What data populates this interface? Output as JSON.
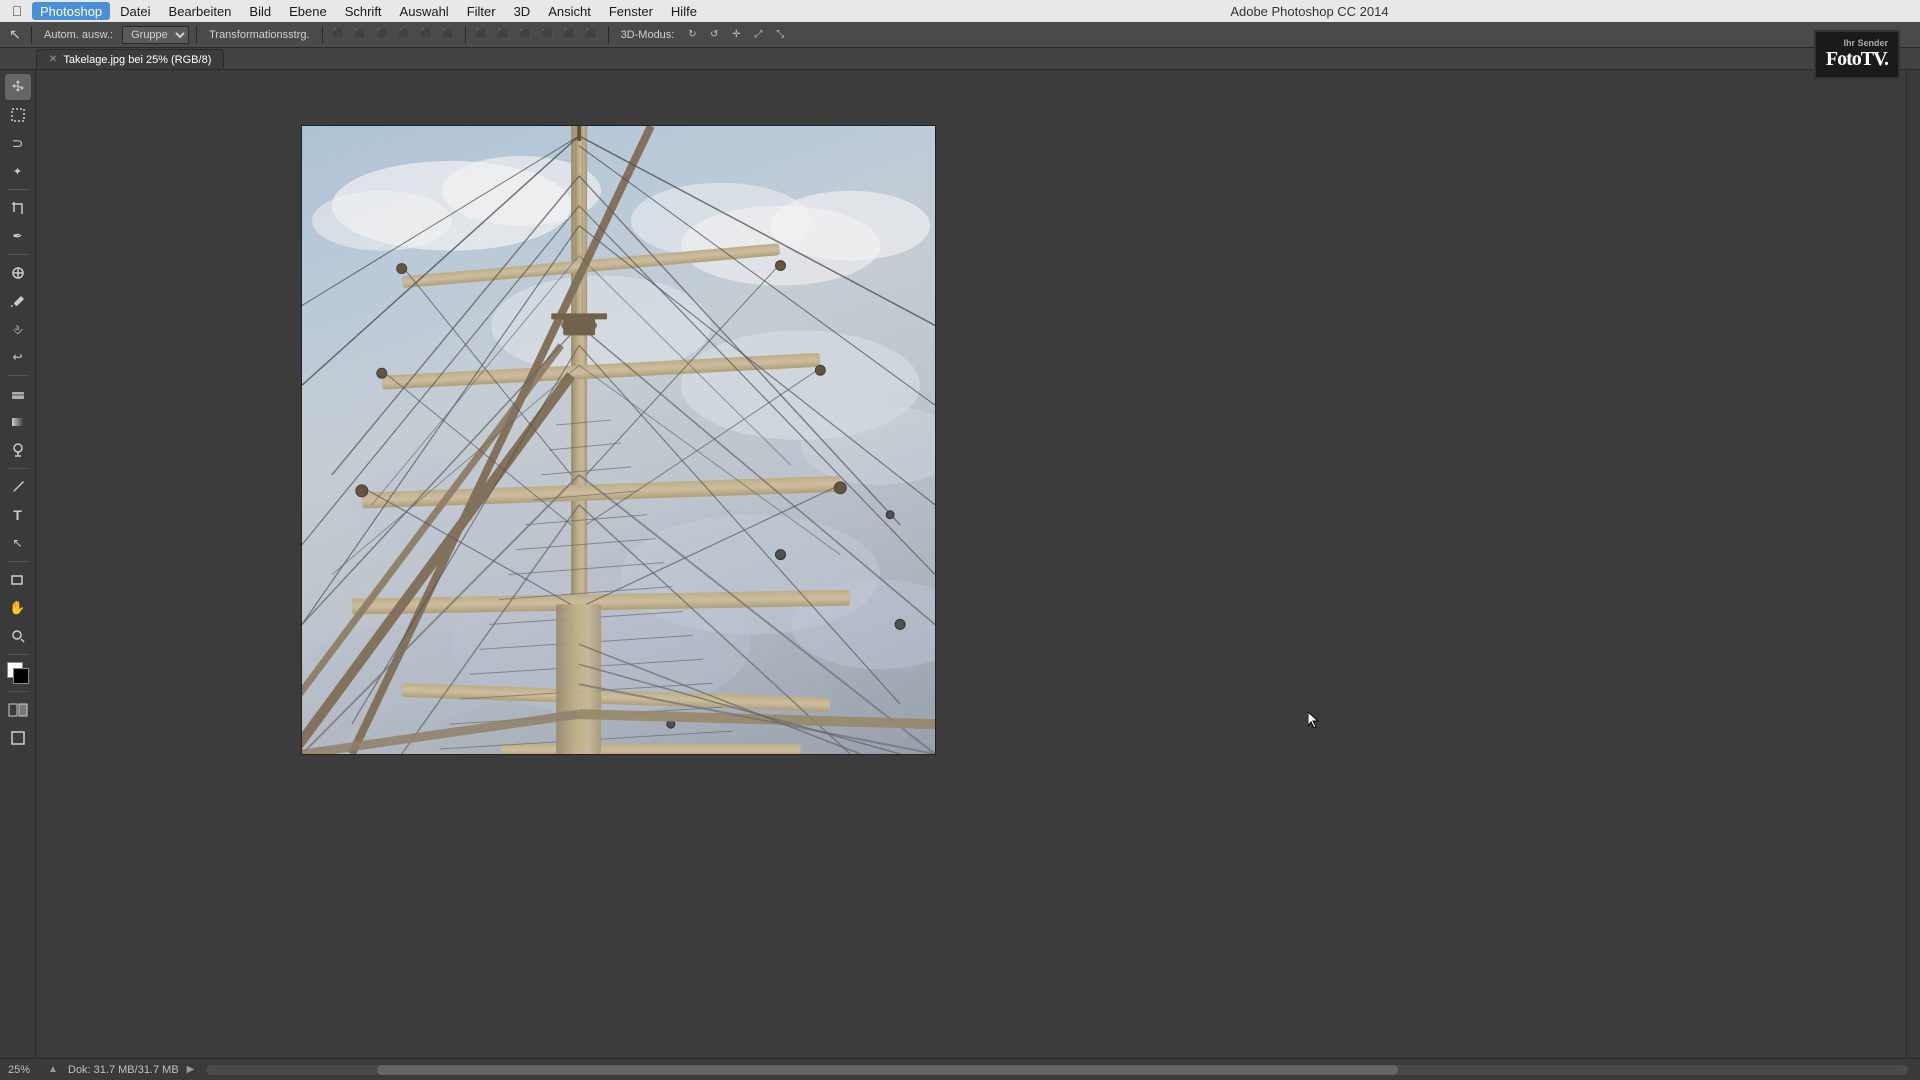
{
  "app": {
    "title": "Adobe Photoshop CC 2014",
    "name": "Photoshop"
  },
  "menubar": {
    "apple": "⌘",
    "items": [
      {
        "label": "Photoshop",
        "active": true
      },
      {
        "label": "Datei"
      },
      {
        "label": "Bearbeiten"
      },
      {
        "label": "Bild"
      },
      {
        "label": "Ebene"
      },
      {
        "label": "Schrift"
      },
      {
        "label": "Auswahl"
      },
      {
        "label": "Filter"
      },
      {
        "label": "3D"
      },
      {
        "label": "Ansicht"
      },
      {
        "label": "Fenster"
      },
      {
        "label": "Hilfe"
      }
    ]
  },
  "toolbar": {
    "autom_label": "Autom. ausw.:",
    "gruppe_label": "Gruppe",
    "transformation_label": "Transformationsstrg.",
    "modus_label": "3D-Modus:"
  },
  "tab": {
    "filename": "Takelage.jpg bei 25% (RGB/8)"
  },
  "statusbar": {
    "zoom": "25%",
    "doc_info": "Dok: 31.7 MB/31.7 MB"
  },
  "fototv": {
    "text": "FotoTV.",
    "subtitle": "Ihr Sender"
  },
  "tools": [
    {
      "name": "move-tool",
      "icon": "↖",
      "label": "Verschieben"
    },
    {
      "name": "marquee-tool",
      "icon": "⬜",
      "label": "Auswahl"
    },
    {
      "name": "lasso-tool",
      "icon": "⌀",
      "label": "Lasso"
    },
    {
      "name": "magic-wand",
      "icon": "✦",
      "label": "Zauberstab"
    },
    {
      "name": "crop-tool",
      "icon": "⊡",
      "label": "Freistellen"
    },
    {
      "name": "eyedropper",
      "icon": "✏",
      "label": "Pipette"
    },
    {
      "name": "healing-brush",
      "icon": "⊕",
      "label": "Reparatur"
    },
    {
      "name": "brush-tool",
      "icon": "𝄞",
      "label": "Pinsel"
    },
    {
      "name": "clone-stamp",
      "icon": "✓",
      "label": "Stempel"
    },
    {
      "name": "history-brush",
      "icon": "↩",
      "label": "Protokoll"
    },
    {
      "name": "eraser-tool",
      "icon": "◻",
      "label": "Radierer"
    },
    {
      "name": "gradient-tool",
      "icon": "▦",
      "label": "Verlauf"
    },
    {
      "name": "burn-tool",
      "icon": "⚆",
      "label": "Abwedler"
    },
    {
      "name": "pen-tool",
      "icon": "✒",
      "label": "Pfad"
    },
    {
      "name": "type-tool",
      "icon": "T",
      "label": "Schrift"
    },
    {
      "name": "path-tool",
      "icon": "◇",
      "label": "Pfadauswahl"
    },
    {
      "name": "shape-tool",
      "icon": "▭",
      "label": "Form"
    },
    {
      "name": "hand-tool",
      "icon": "✋",
      "label": "Hand"
    },
    {
      "name": "zoom-tool",
      "icon": "⊕",
      "label": "Zoom"
    },
    {
      "name": "fg-color",
      "icon": "",
      "label": "Vordergrundfarbe"
    },
    {
      "name": "bg-color",
      "icon": "",
      "label": "Hintergrundfarbe"
    },
    {
      "name": "quick-mask",
      "icon": "◉",
      "label": "Schnellmaske"
    },
    {
      "name": "screen-mode",
      "icon": "⊟",
      "label": "Bildschirmmodus"
    }
  ]
}
